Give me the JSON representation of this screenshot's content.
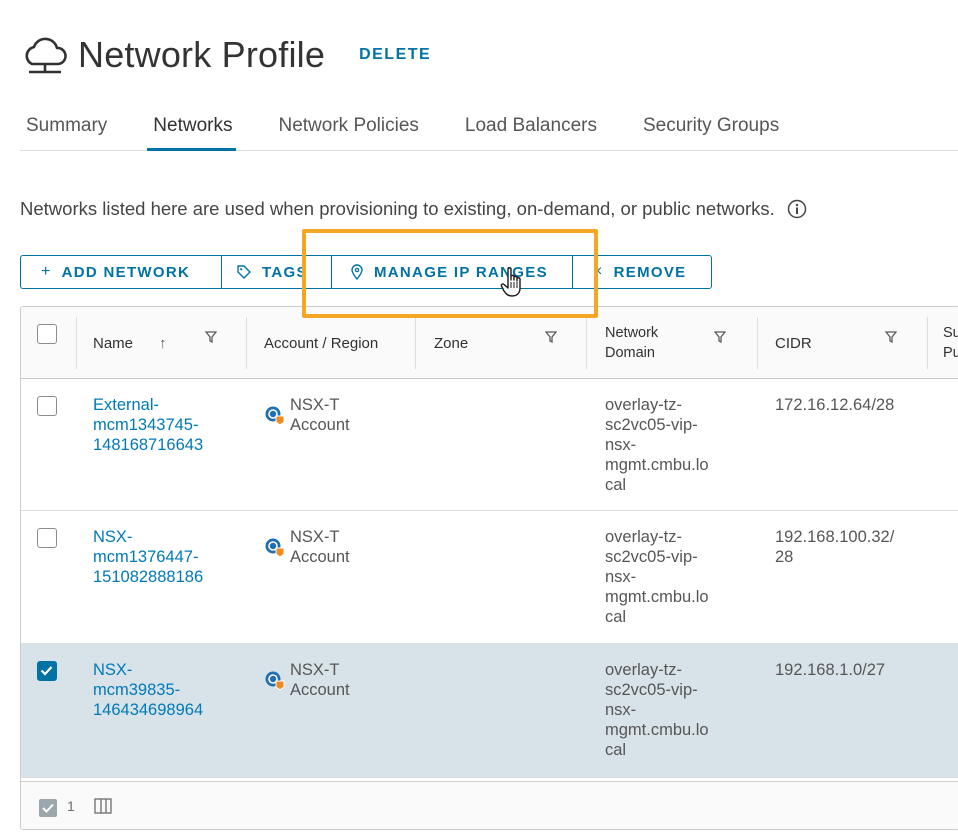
{
  "header": {
    "icon": "cloud-network-icon",
    "title": "Network Profile",
    "delete_label": "DELETE"
  },
  "tabs": [
    {
      "label": "Summary",
      "active": false
    },
    {
      "label": "Networks",
      "active": true
    },
    {
      "label": "Network Policies",
      "active": false
    },
    {
      "label": "Load Balancers",
      "active": false
    },
    {
      "label": "Security Groups",
      "active": false
    }
  ],
  "description": "Networks listed here are used when provisioning to existing, on-demand, or public networks.",
  "toolbar": {
    "add_network": "ADD NETWORK",
    "tags": "TAGS",
    "manage_ip_ranges": "MANAGE IP RANGES",
    "remove": "REMOVE"
  },
  "grid": {
    "columns": {
      "name": "Name",
      "account_region": "Account / Region",
      "zone": "Zone",
      "network_domain_1": "Network",
      "network_domain_2": "Domain",
      "cidr": "CIDR",
      "support_public_1": "Su",
      "support_public_2": "Pu"
    },
    "rows": [
      {
        "selected": false,
        "name_lines": [
          "External-",
          "mcm1343745-",
          "148168716643"
        ],
        "account_lines": [
          "NSX-T",
          "Account"
        ],
        "zone": "",
        "domain_lines": [
          "overlay-tz-",
          "sc2vc05-vip-",
          "nsx-",
          "mgmt.cmbu.lo",
          "cal"
        ],
        "cidr_lines": [
          "172.16.12.64/28"
        ]
      },
      {
        "selected": false,
        "name_lines": [
          "NSX-",
          "mcm1376447-",
          "151082888186"
        ],
        "account_lines": [
          "NSX-T",
          "Account"
        ],
        "zone": "",
        "domain_lines": [
          "overlay-tz-",
          "sc2vc05-vip-",
          "nsx-",
          "mgmt.cmbu.lo",
          "cal"
        ],
        "cidr_lines": [
          "192.168.100.32/",
          "28"
        ]
      },
      {
        "selected": true,
        "name_lines": [
          "NSX-",
          "mcm39835-",
          "146434698964"
        ],
        "account_lines": [
          "NSX-T",
          "Account"
        ],
        "zone": "",
        "domain_lines": [
          "overlay-tz-",
          "sc2vc05-vip-",
          "nsx-",
          "mgmt.cmbu.lo",
          "cal"
        ],
        "cidr_lines": [
          "192.168.1.0/27"
        ]
      }
    ],
    "footer": {
      "selected_count": "1"
    }
  },
  "colors": {
    "accent": "#0072a3",
    "link": "#0079b8",
    "highlight": "#f4a725",
    "selected_row": "#d8e3e9"
  }
}
